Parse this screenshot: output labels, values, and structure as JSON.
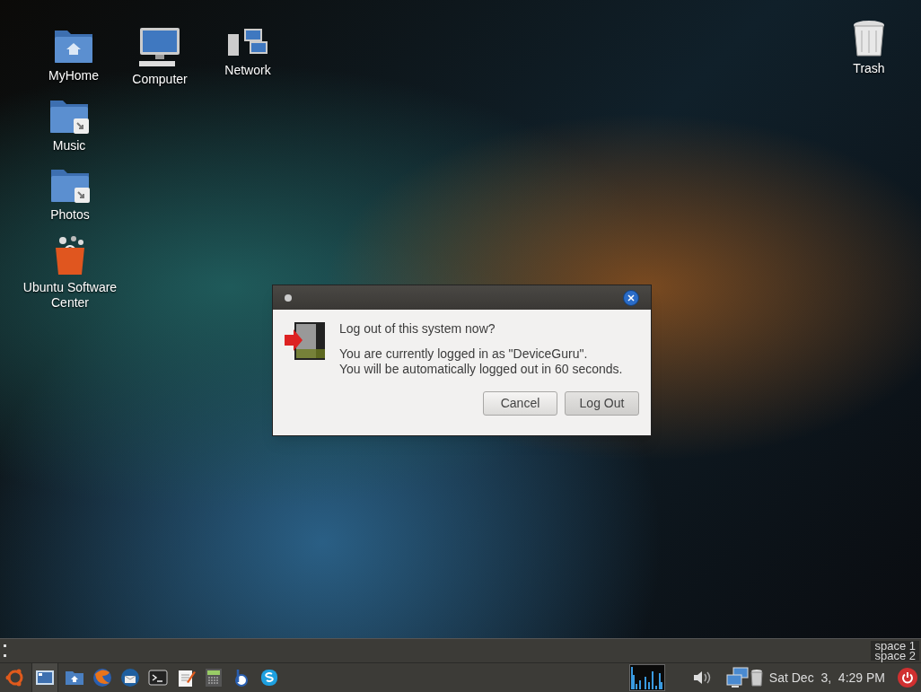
{
  "desktop_icons": [
    {
      "label": "MyHome",
      "kind": "home-folder"
    },
    {
      "label": "Computer",
      "kind": "computer"
    },
    {
      "label": "Network",
      "kind": "network"
    },
    {
      "label": "Music",
      "kind": "link-folder"
    },
    {
      "label": "Photos",
      "kind": "link-folder"
    },
    {
      "label": "Ubuntu Software Center",
      "kind": "store"
    },
    {
      "label": "Trash",
      "kind": "trash"
    }
  ],
  "dialog": {
    "heading": "Log out of this system now?",
    "message": [
      "You are currently logged in as \"DeviceGuru\".",
      "You will be automatically logged out in 60 seconds."
    ],
    "buttons": [
      "Cancel",
      "Log Out"
    ]
  },
  "panel": {
    "workspaces": [
      "space 1",
      "space 2"
    ],
    "clock": "Sat Dec  3,  4:29 PM"
  }
}
